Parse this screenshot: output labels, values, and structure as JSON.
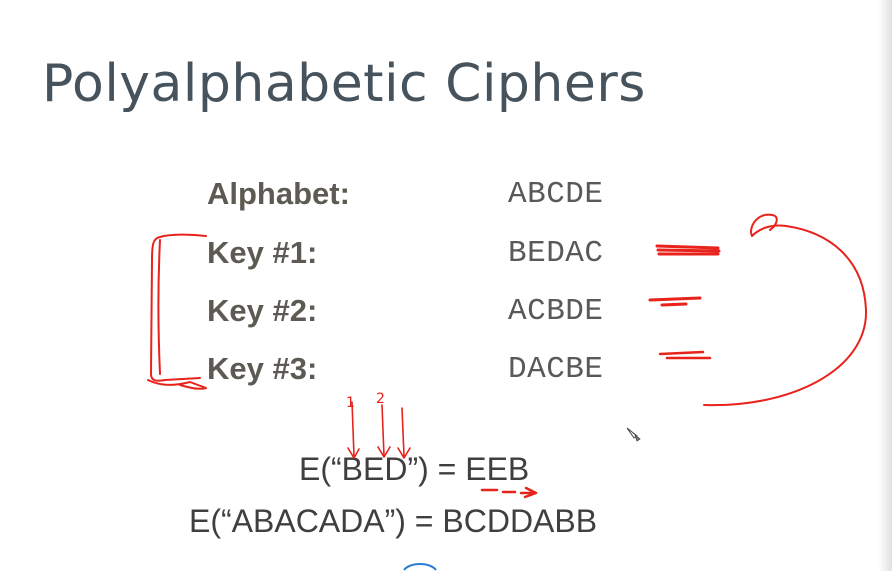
{
  "slide": {
    "title": "Polyalphabetic Ciphers",
    "rows": [
      {
        "label": "Alphabet:",
        "value": "ABCDE"
      },
      {
        "label": "Key #1:",
        "value": "BEDAC"
      },
      {
        "label": "Key #2:",
        "value": "ACBDE"
      },
      {
        "label": "Key #3:",
        "value": "DACBE"
      }
    ],
    "equations": [
      {
        "text": "E(“BED”) = EEB"
      },
      {
        "text": "E(“ABACADA”) = BCDDABB"
      }
    ]
  },
  "annotations": {
    "ink_color": "#e8231c",
    "handwritten_numbers": [
      "1",
      "2"
    ]
  },
  "icons": [
    "pen-cursor-icon",
    "nav-arc-icon"
  ]
}
